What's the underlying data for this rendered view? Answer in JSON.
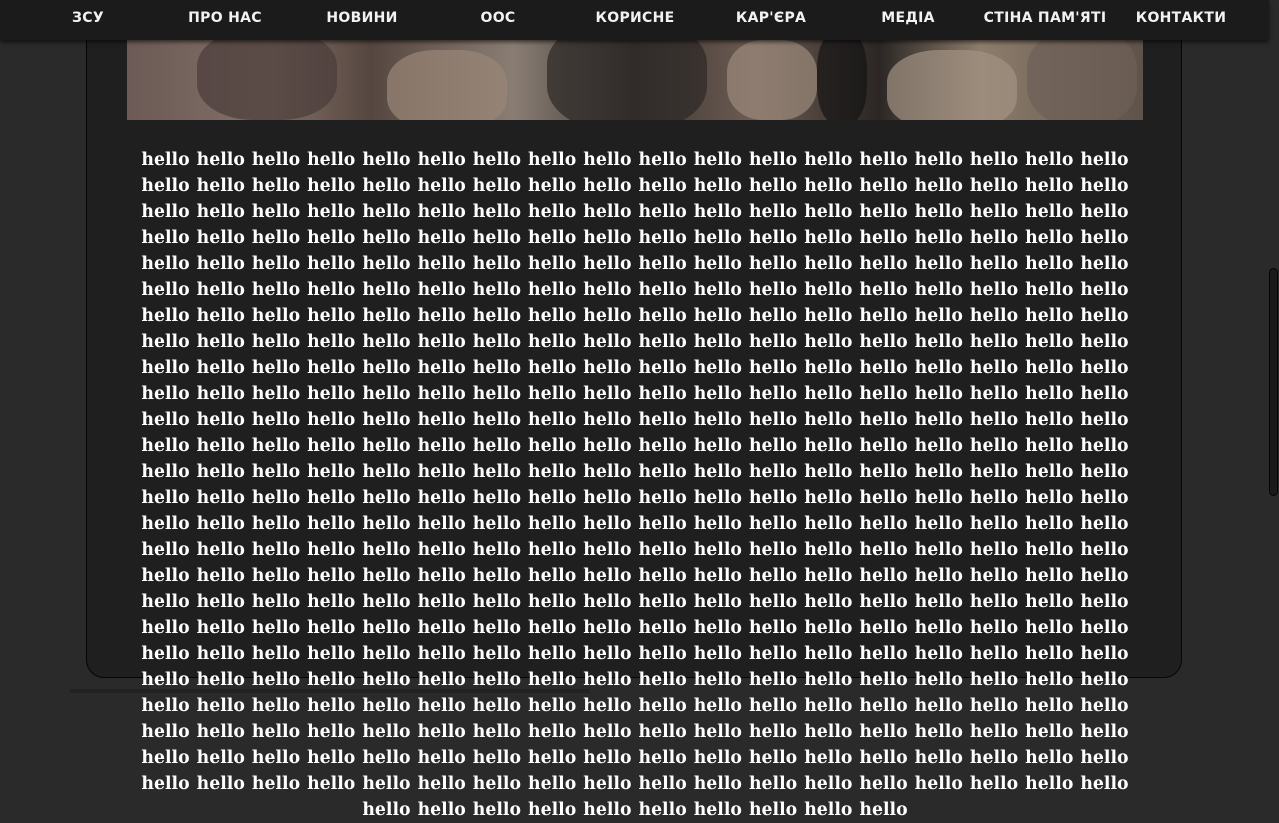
{
  "nav": {
    "items": [
      {
        "label": "ЗСУ"
      },
      {
        "label": "ПРО НАС"
      },
      {
        "label": "НОВИНИ"
      },
      {
        "label": "ООС"
      },
      {
        "label": "КОРИСНЕ"
      },
      {
        "label": "КАР'ЄРА"
      },
      {
        "label": "МЕДІА"
      },
      {
        "label": "СТІНА ПАМ'ЯТІ"
      },
      {
        "label": "КОНТАКТИ"
      }
    ]
  },
  "article": {
    "body": "hello hello hello hello hello hello hello hello hello hello hello hello hello hello hello hello hello hello hello hello hello hello hello hello hello hello hello hello hello hello hello hello hello hello hello hello hello hello hello hello hello hello hello hello hello hello hello hello hello hello hello hello hello hello hello hello hello hello hello hello hello hello hello hello hello hello hello hello hello hello hello hello hello hello hello hello hello hello hello hello hello hello hello hello hello hello hello hello hello hello hello hello hello hello hello hello hello hello hello hello hello hello hello hello hello hello hello hello hello hello hello hello hello hello hello hello hello hello hello hello hello hello hello hello hello hello hello hello hello hello hello hello hello hello hello hello hello hello hello hello hello hello hello hello hello hello hello hello hello hello hello hello hello hello hello hello hello hello hello hello hello hello hello hello hello hello hello hello hello hello hello hello hello hello hello hello hello hello hello hello hello hello hello hello hello hello hello hello hello hello hello hello hello hello hello hello hello hello hello hello hello hello hello hello hello hello hello hello hello hello hello hello hello hello hello hello hello hello hello hello hello hello hello hello hello hello hello hello hello hello hello hello hello hello hello hello hello hello hello hello hello hello hello hello hello hello hello hello hello hello hello hello hello hello hello hello hello hello hello hello hello hello hello hello hello hello hello hello hello hello hello hello hello hello hello hello hello hello hello hello hello hello hello hello hello hello hello hello hello hello hello hello hello hello hello hello hello hello hello hello hello hello hello hello hello hello hello hello hello hello hello hello hello hello hello hello hello hello hello hello hello hello hello hello hello hello hello hello hello hello hello hello hello hello hello hello hello hello hello hello hello hello hello hello hello hello hello hello hello hello hello hello hello hello hello hello hello hello hello hello hello hello hello hello hello hello hello hello hello hello hello hello hello hello hello hello hello hello hello hello hello hello hello hello hello hello hello hello hello hello hello hello hello hello hello hello hello hello hello hello hello hello hello hello hello hello hello hello hello hello hello hello hello hello hello hello hello hello hello hello hello hello hello hello hello hello hello hello hello hello hello hello hello hello hello hello hello hello hello hello hello hello hello hello hello hello hello hello hello hello hello hello hello hello hello hello hello hello hello hello"
  },
  "colors": {
    "background": "#2a2a2a",
    "nav_bg": "#1b1b1b",
    "card_bg": "#1f1f1f",
    "text": "#ffffff"
  }
}
